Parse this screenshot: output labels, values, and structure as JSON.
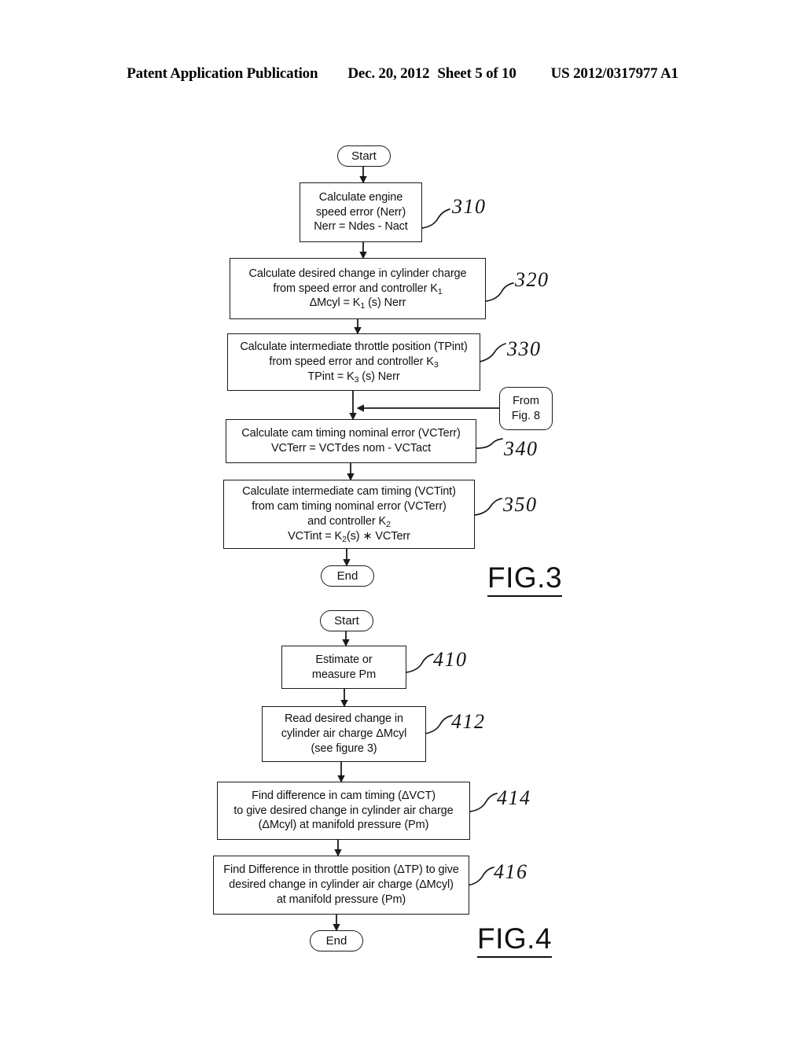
{
  "header": {
    "publication": "Patent Application Publication",
    "date": "Dec. 20, 2012",
    "sheet": "Sheet 5 of 10",
    "doc_number": "US 2012/0317977 A1"
  },
  "figures": [
    {
      "caption": "FIG.3",
      "start_label": "Start",
      "end_label": "End",
      "connector": {
        "line1": "From",
        "line2": "Fig. 8"
      },
      "steps": [
        {
          "ref": "310",
          "lines": [
            "Calculate engine",
            "speed error (Nerr)",
            "Nerr = Ndes - Nact"
          ]
        },
        {
          "ref": "320",
          "lines": [
            "Calculate desired change in cylinder charge",
            "from speed error and controller K1",
            "ΔMcyl = K1 (s) Nerr"
          ]
        },
        {
          "ref": "330",
          "lines": [
            "Calculate intermediate throttle position (TPint)",
            "from speed error and controller K3",
            "TPint = K3 (s) Nerr"
          ]
        },
        {
          "ref": "340",
          "lines": [
            "Calculate cam timing nominal error (VCTerr)",
            "VCTerr = VCTdes nom - VCTact"
          ]
        },
        {
          "ref": "350",
          "lines": [
            "Calculate intermediate cam timing (VCTint)",
            "from cam timing nominal error (VCTerr)",
            "and controller K2",
            "VCTint = K2(s) ∗ VCTerr"
          ]
        }
      ]
    },
    {
      "caption": "FIG.4",
      "start_label": "Start",
      "end_label": "End",
      "steps": [
        {
          "ref": "410",
          "lines": [
            "Estimate or",
            "measure Pm"
          ]
        },
        {
          "ref": "412",
          "lines": [
            "Read desired change in",
            "cylinder air charge ΔMcyl",
            "(see figure 3)"
          ]
        },
        {
          "ref": "414",
          "lines": [
            "Find difference in cam timing (ΔVCT)",
            "to give desired change in cylinder air charge",
            "(ΔMcyl) at manifold pressure (Pm)"
          ]
        },
        {
          "ref": "416",
          "lines": [
            "Find Difference in throttle position (ΔTP) to give",
            "desired change in cylinder air charge (ΔMcyl)",
            "at manifold pressure (Pm)"
          ]
        }
      ]
    }
  ],
  "colors": {
    "ink": "#111111",
    "paper": "#ffffff"
  }
}
